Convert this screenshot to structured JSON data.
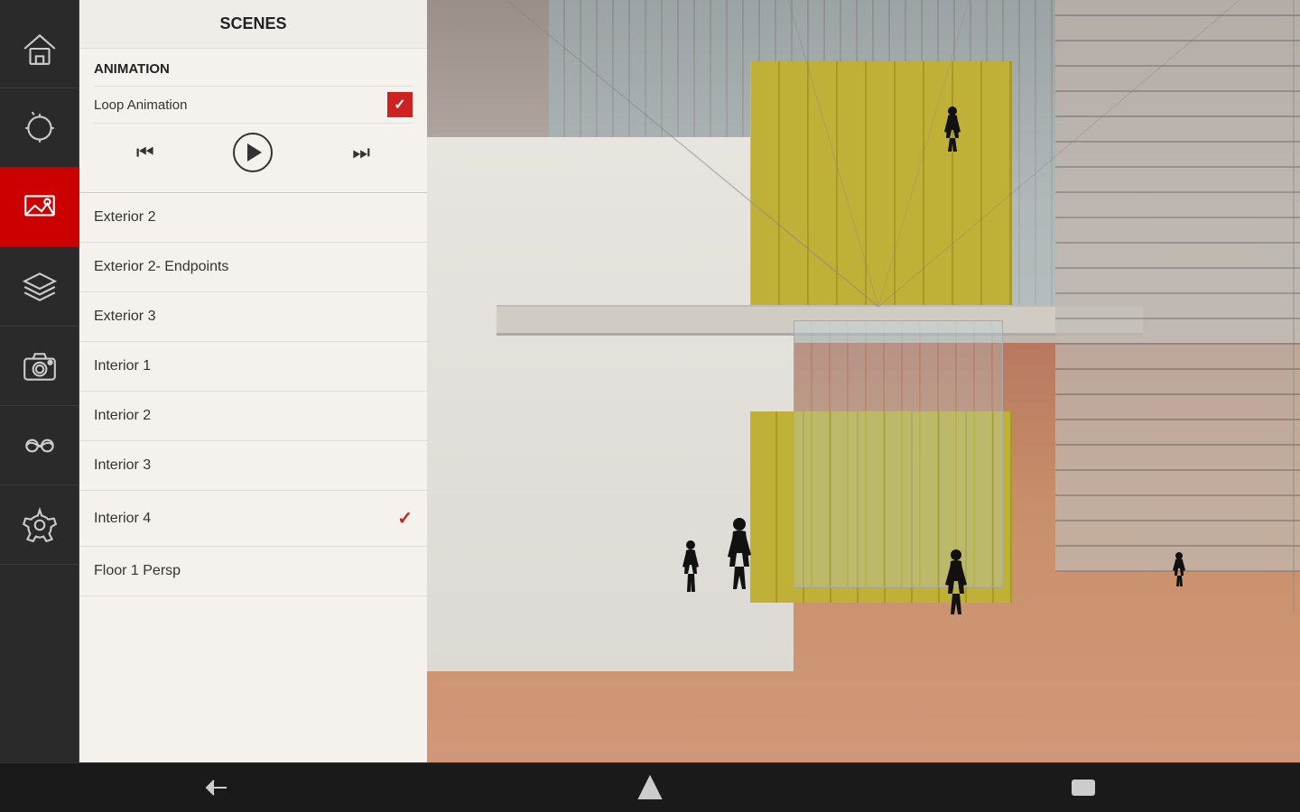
{
  "panel": {
    "title": "SCENES",
    "animation": {
      "label": "ANIMATION",
      "loop_label": "Loop Animation",
      "loop_checked": true
    },
    "scenes": [
      {
        "id": "exterior2",
        "name": "Exterior 2",
        "active": false
      },
      {
        "id": "exterior2ep",
        "name": "Exterior 2- Endpoints",
        "active": false
      },
      {
        "id": "exterior3",
        "name": "Exterior 3",
        "active": false
      },
      {
        "id": "interior1",
        "name": "Interior 1",
        "active": false
      },
      {
        "id": "interior2",
        "name": "Interior 2",
        "active": false
      },
      {
        "id": "interior3",
        "name": "Interior 3",
        "active": false
      },
      {
        "id": "interior4",
        "name": "Interior 4",
        "active": true
      },
      {
        "id": "floor1persp",
        "name": "Floor 1 Persp",
        "active": false
      }
    ]
  },
  "nav": {
    "back_label": "back",
    "home_label": "home",
    "recents_label": "recents"
  },
  "sidebar": {
    "items": [
      {
        "id": "home",
        "label": "home"
      },
      {
        "id": "measure",
        "label": "measure"
      },
      {
        "id": "scenes",
        "label": "scenes",
        "active": true
      },
      {
        "id": "layers",
        "label": "layers"
      },
      {
        "id": "camera",
        "label": "camera"
      },
      {
        "id": "vr",
        "label": "vr"
      },
      {
        "id": "settings",
        "label": "settings"
      }
    ]
  }
}
